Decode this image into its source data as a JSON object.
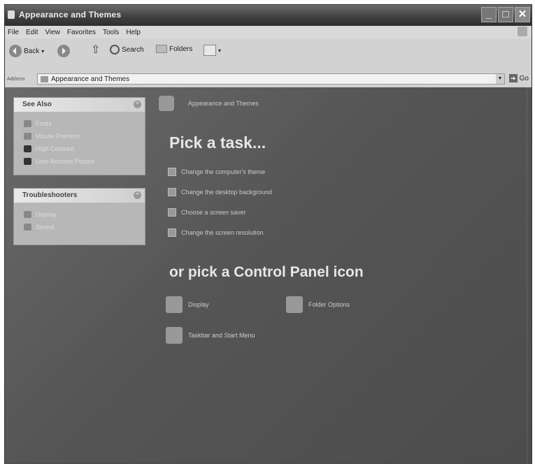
{
  "window": {
    "title": "Appearance and Themes"
  },
  "menu": [
    "File",
    "Edit",
    "View",
    "Favorites",
    "Tools",
    "Help"
  ],
  "toolbar": {
    "back": "Back",
    "search": "Search",
    "folders": "Folders"
  },
  "address": {
    "label": "Address",
    "value": "Appearance and Themes",
    "go": "Go"
  },
  "see_also": {
    "title": "See Also",
    "items": [
      "Fonts",
      "Mouse Pointers",
      "High Contrast",
      "User Account Picture"
    ]
  },
  "troubleshooters": {
    "title": "Troubleshooters",
    "items": [
      "Display",
      "Sound"
    ]
  },
  "category": {
    "label": "Appearance and Themes"
  },
  "pick_task": {
    "heading": "Pick a task...",
    "tasks": [
      "Change the computer's theme",
      "Change the desktop background",
      "Choose a screen saver",
      "Change the screen resolution"
    ]
  },
  "pick_icon": {
    "heading": "or pick a Control Panel icon",
    "icons": [
      "Display",
      "Folder Options",
      "Taskbar and Start Menu"
    ]
  }
}
